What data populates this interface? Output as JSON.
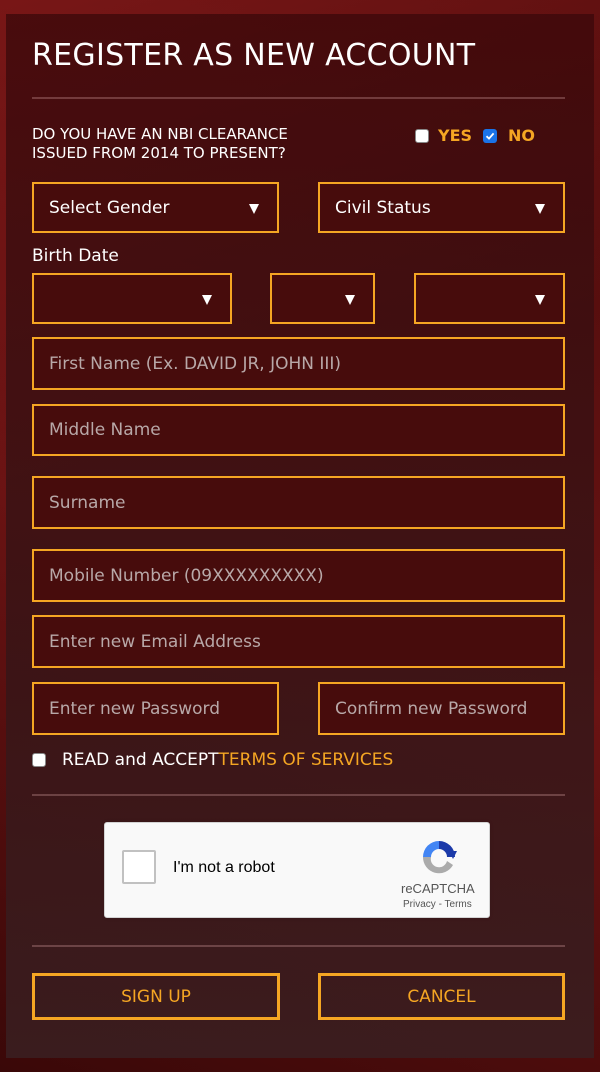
{
  "page": {
    "title": "REGISTER AS NEW ACCOUNT"
  },
  "nbi_question": {
    "line1": "DO YOU HAVE AN NBI CLEARANCE",
    "line2": "ISSUED FROM 2014 TO PRESENT?",
    "yes_label": "YES",
    "no_label": "NO",
    "yes_checked": false,
    "no_checked": true
  },
  "selects": {
    "gender": "Select Gender",
    "civil_status": "Civil Status"
  },
  "birth_date": {
    "label": "Birth Date",
    "month": "",
    "day": "",
    "year": ""
  },
  "fields": {
    "first_name_placeholder": "First Name (Ex. DAVID JR, JOHN III)",
    "middle_name_placeholder": "Middle Name",
    "surname_placeholder": "Surname",
    "mobile_placeholder": "Mobile Number (09XXXXXXXXX)",
    "email_placeholder": "Enter new Email Address",
    "password_placeholder": "Enter new Password",
    "confirm_password_placeholder": "Confirm new Password"
  },
  "terms": {
    "prefix": "READ and ACCEPT ",
    "link": "TERMS OF SERVICES",
    "checked": false
  },
  "captcha": {
    "label": "I'm not a robot",
    "brand": "reCAPTCHA",
    "privacy": "Privacy",
    "separator": " - ",
    "terms": "Terms"
  },
  "buttons": {
    "sign_up": "SIGN UP",
    "cancel": "CANCEL"
  },
  "colors": {
    "accent": "#f5a623",
    "field_bg": "#470c0c",
    "checkbox_checked": "#1a73e8"
  }
}
